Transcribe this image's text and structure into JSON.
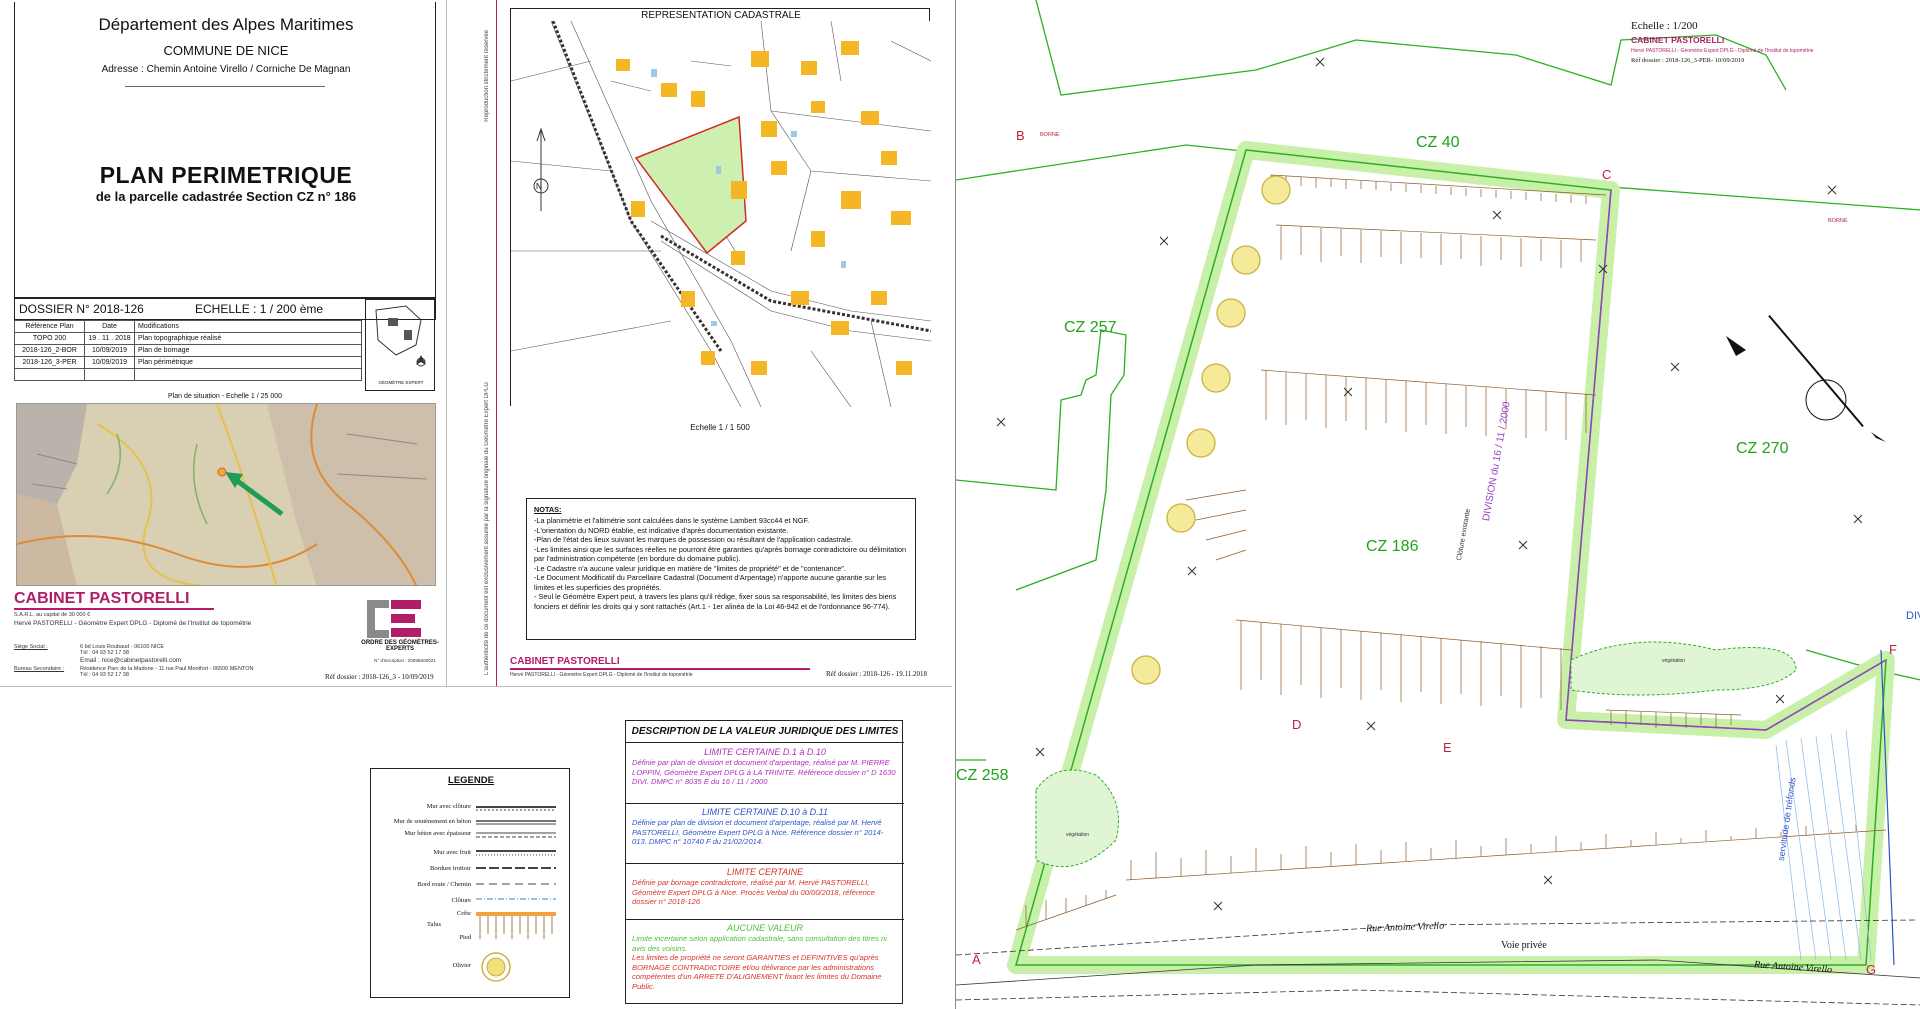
{
  "title_block": {
    "department": "Département des Alpes Maritimes",
    "commune": "COMMUNE DE NICE",
    "address": "Adresse : Chemin Antoine Virello / Corniche De Magnan",
    "plan_title": "PLAN PERIMETRIQUE",
    "plan_subtitle": "de la parcelle cadastrée Section CZ n° 186",
    "dossier": "DOSSIER N° 2018-126",
    "echelle": "ECHELLE : 1 / 200 ème",
    "table_headers": [
      "Référence Plan",
      "Date",
      "Modifications"
    ],
    "table_rows": [
      [
        "TOPO 200",
        "19 . 11 . 2018",
        "Plan topographique réalisé"
      ],
      [
        "2018-126_2-BOR",
        "10/09/2019",
        "Plan de bornage"
      ],
      [
        "2018-126_3-PER",
        "10/09/2019",
        "Plan périmétrique"
      ]
    ],
    "geometre_caption": "GÉOMÈTRE EXPERT",
    "situation_caption": "Plan de situation  -  Echelle 1 / 25 000"
  },
  "cabinet": {
    "name": "CABINET PASTORELLI",
    "capital": "S.A.R.L. au capital de 30 000 €",
    "principal": "Hervé PASTORELLI - Géomètre Expert DPLG - Diplomé de l'Institut de topométrie",
    "siege_label": "Siège Social :",
    "siege_addr": "6 bd Louis Roubaud - 06100 NICE",
    "tel": "Tél : 04 93 52 17 38",
    "email": "Email : nice@cabinetpastorelli.com",
    "bureau_label": "Bureau Secondaire :",
    "bureau_addr": "Résidence Parc de la Madone - 11 rue Paul Montfort - 06500 MENTON",
    "bureau_tel": "Tél : 04 93 52 17 38",
    "ordre": "ORDRE DES GÉOMÈTRES-EXPERTS",
    "inscription": "N° d'inscription : 2009B200021",
    "ref": "Réf dossier : 2018-126_3 - 10/09/2019"
  },
  "cadastre": {
    "title": "REPRESENTATION CADASTRALE",
    "scale": "Echelle 1 / 1 500",
    "north": "N",
    "notes_title": "NOTAS:",
    "notes": [
      "-La planimétrie et l'altimétrie sont calculées dans le système Lambert 93cc44 et NGF.",
      "-L'orientation du NORD établie, est indicative d'après documentation existante.",
      "-Plan de l'état des lieux suivant les marques de  possession ou résultant  de l'application  cadastrale.",
      "-Les limites ainsi que les surfaces réelles ne pourront être garanties qu'après bornage contradictoire ou délimitation par l'administration compétente (en bordure du domaine public).",
      "-Le Cadastre n'a aucune valeur juridique en matière de \"limites de propriété\" et de \"contenance\".",
      "-Le Document Modificatif du Parcellaire Cadastral (Document d'Arpentage) n'apporte aucune garantie sur les limites et les superficies des propriétés.",
      "- Seul le Géomètre Expert peut, à travers les plans qu'il rédige, fixer sous sa responsabilité, les limites des biens fonciers et définir les droits qui y sont rattachés (Art.1 - 1er alinéa de la Loi 46-942 et de l'ordonnance 96-774)."
    ],
    "cabinet": "CABINET PASTORELLI",
    "cabinet_sub": "Hervé PASTORELLI - Géomètre Expert DPLG - Diplomé de l'Institut de topométrie",
    "ref": "Réf dossier : 2018-126  -  19.11.2018",
    "vertical_left": "Reproduction strictement réservée",
    "vertical_right": "L'authenticité de ce document est exclusivement assurée par la signature originale du Géomètre Expert DPLG"
  },
  "legend": {
    "title": "LEGENDE",
    "items": [
      "Mur avec clôture",
      "Mur de soutènement en béton",
      "Mur béton avec épaisseur",
      "Mur avec fruit",
      "Bordure trottoir",
      "Bord route / Chemin",
      "Clôture",
      "Crête",
      "Talus",
      "Pied",
      "Olivier"
    ]
  },
  "description": {
    "title": "DESCRIPTION DE LA VALEUR JURIDIQUE DES LIMITES",
    "blocks": [
      {
        "head": "LIMITE CERTAINE  D.1 à D.10",
        "text": "Définie par plan de division et document d'arpentage, réalisé par M. PIERRE LOPPIN, Géomètre Expert DPLG à LA TRINITE. Référence dossier n° D 1630 DIVI. DMPC n° 8035 E du 16 / 11 / 2000",
        "color": "#b02dbd"
      },
      {
        "head": "LIMITE CERTAINE  D.10 à D.11",
        "text": "Définie par plan de division et document d'arpentage, réalisé par M. Hervé PASTORELLI, Géomètre Expert DPLG à Nice. Référence dossier n° 2014-013. DMPC n° 10740 F du 21/02/2014.",
        "color": "#2b55c7"
      },
      {
        "head": "LIMITE CERTAINE",
        "text": "Définie par bornage contradictoire, réalisé par M. Hervé PASTORELLI, Géomètre Expert DPLG à Nice. Procès Verbal du 00/00/2018, référence dossier n° 2018-126",
        "color": "#d9332b"
      },
      {
        "head": "AUCUNE VALEUR",
        "text": "Limite incertaine selon application cadastrale, sans consultation des titres ni avis des voisins.",
        "text2": "Les limites de propriété ne seront GARANTIES et DEFINITIVES qu'après BORNAGE CONTRADICTOIRE et/ou délivrance par les administrations compétentes d'un ARRETE D'ALIGNEMENT fixant les limites du Domaine Public.",
        "color": "#4fbf3b",
        "color2": "#d9332b"
      }
    ]
  },
  "plan": {
    "echelle": "Echelle : 1/200",
    "cabinet": "CABINET PASTORELLI",
    "cabinet_sub": "Hervé PASTORELLI - Géomètre Expert DPLG - Diplomé de l'Institut de topométrie",
    "ref": "Réf dossier : 2018-126_3-PER- 10/09/2019",
    "parcels": [
      "CZ 40",
      "CZ 257",
      "CZ 270",
      "CZ 186",
      "CZ 258"
    ],
    "points": [
      "A",
      "B",
      "C",
      "D",
      "E",
      "F",
      "G"
    ],
    "roads": [
      "Rue Antoine Virello",
      "Voie privée",
      "Rue Antoine Virello"
    ],
    "annotations": [
      "DIVISION du 16 / 11 / 2000",
      "Clôture existante",
      "servitude de tréfonds",
      "végétation",
      "végétation",
      "BORNE",
      "BORNE",
      "DIVI"
    ],
    "colors": {
      "limit_green": "#2bb024",
      "band_green": "#c9f0a8",
      "division": "#9b3fc4",
      "point": "#c0213d",
      "talus": "#8a5a2b",
      "olivier": "#c9b23d"
    }
  }
}
